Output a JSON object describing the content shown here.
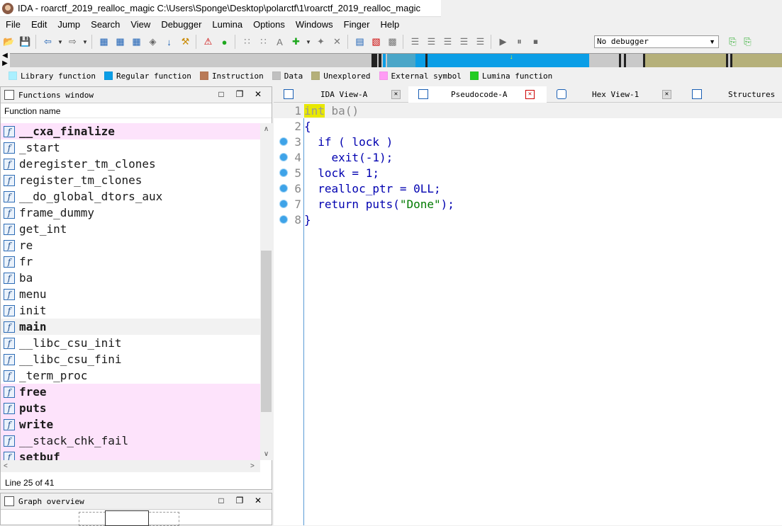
{
  "window": {
    "title": "IDA - roarctf_2019_realloc_magic C:\\Users\\Sponge\\Desktop\\polarctf\\1\\roarctf_2019_realloc_magic"
  },
  "menu": [
    "File",
    "Edit",
    "Jump",
    "Search",
    "View",
    "Debugger",
    "Lumina",
    "Options",
    "Windows",
    "Finger",
    "Help"
  ],
  "toolbar": {
    "debugger_select": "No debugger"
  },
  "legend": [
    {
      "label": "Library function",
      "color": "#aaf0ff"
    },
    {
      "label": "Regular function",
      "color": "#0b9ee6"
    },
    {
      "label": "Instruction",
      "color": "#b97a57"
    },
    {
      "label": "Data",
      "color": "#c0c0c0"
    },
    {
      "label": "Unexplored",
      "color": "#b5b07a"
    },
    {
      "label": "External symbol",
      "color": "#ff9cf5"
    },
    {
      "label": "Lumina function",
      "color": "#22cc22"
    }
  ],
  "functions_window": {
    "title": "Functions window",
    "column": "Function name",
    "items": [
      {
        "name": "__cxa_finalize",
        "ext": true,
        "bold": true
      },
      {
        "name": "_start"
      },
      {
        "name": "deregister_tm_clones"
      },
      {
        "name": "register_tm_clones"
      },
      {
        "name": "__do_global_dtors_aux"
      },
      {
        "name": "frame_dummy"
      },
      {
        "name": "get_int"
      },
      {
        "name": "re"
      },
      {
        "name": "fr"
      },
      {
        "name": "ba"
      },
      {
        "name": "menu"
      },
      {
        "name": "init"
      },
      {
        "name": "main",
        "bold": true,
        "selected": true
      },
      {
        "name": "__libc_csu_init"
      },
      {
        "name": "__libc_csu_fini"
      },
      {
        "name": "_term_proc"
      },
      {
        "name": "free",
        "ext": true,
        "bold": true
      },
      {
        "name": "puts",
        "ext": true,
        "bold": true
      },
      {
        "name": "write",
        "ext": true,
        "bold": true
      },
      {
        "name": "__stack_chk_fail",
        "ext": true
      },
      {
        "name": "setbuf",
        "ext": true,
        "bold": true
      }
    ],
    "status": "Line 25 of 41"
  },
  "graph_overview": {
    "title": "Graph overview"
  },
  "tabs": [
    {
      "label": "IDA View-A"
    },
    {
      "label": "Pseudocode-A",
      "active": true
    },
    {
      "label": "Hex View-1"
    },
    {
      "label": "Structures"
    }
  ],
  "pseudocode": {
    "lines": [
      {
        "n": "1",
        "text": "int ba()"
      },
      {
        "n": "2",
        "text": "{"
      },
      {
        "n": "3",
        "text": "  if ( lock )"
      },
      {
        "n": "4",
        "text": "    exit(-1);"
      },
      {
        "n": "5",
        "text": "  lock = 1;"
      },
      {
        "n": "6",
        "text": "  realloc_ptr = 0LL;"
      },
      {
        "n": "7",
        "text": "  return puts(\"Done\");"
      },
      {
        "n": "8",
        "text": "}"
      }
    ]
  }
}
